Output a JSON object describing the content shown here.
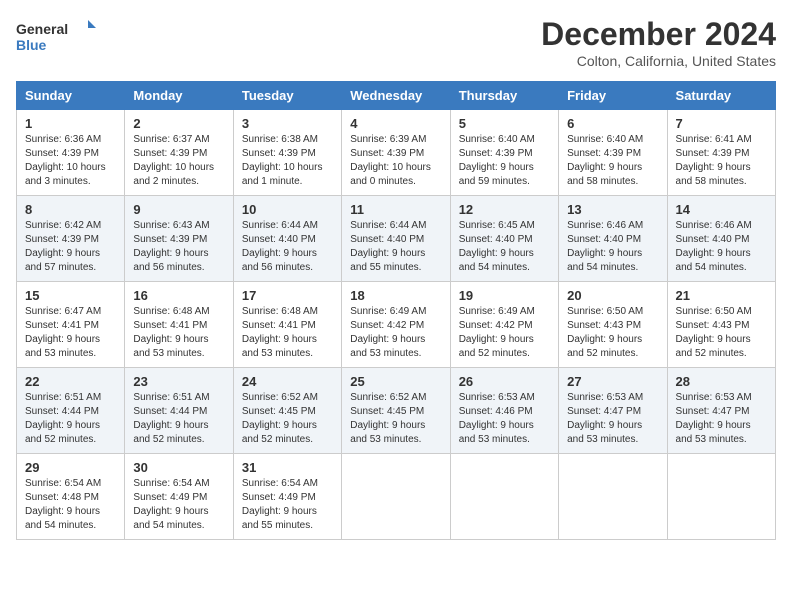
{
  "header": {
    "logo_line1": "General",
    "logo_line2": "Blue",
    "month": "December 2024",
    "location": "Colton, California, United States"
  },
  "days_of_week": [
    "Sunday",
    "Monday",
    "Tuesday",
    "Wednesday",
    "Thursday",
    "Friday",
    "Saturday"
  ],
  "weeks": [
    [
      {
        "day": "1",
        "info": "Sunrise: 6:36 AM\nSunset: 4:39 PM\nDaylight: 10 hours\nand 3 minutes."
      },
      {
        "day": "2",
        "info": "Sunrise: 6:37 AM\nSunset: 4:39 PM\nDaylight: 10 hours\nand 2 minutes."
      },
      {
        "day": "3",
        "info": "Sunrise: 6:38 AM\nSunset: 4:39 PM\nDaylight: 10 hours\nand 1 minute."
      },
      {
        "day": "4",
        "info": "Sunrise: 6:39 AM\nSunset: 4:39 PM\nDaylight: 10 hours\nand 0 minutes."
      },
      {
        "day": "5",
        "info": "Sunrise: 6:40 AM\nSunset: 4:39 PM\nDaylight: 9 hours\nand 59 minutes."
      },
      {
        "day": "6",
        "info": "Sunrise: 6:40 AM\nSunset: 4:39 PM\nDaylight: 9 hours\nand 58 minutes."
      },
      {
        "day": "7",
        "info": "Sunrise: 6:41 AM\nSunset: 4:39 PM\nDaylight: 9 hours\nand 58 minutes."
      }
    ],
    [
      {
        "day": "8",
        "info": "Sunrise: 6:42 AM\nSunset: 4:39 PM\nDaylight: 9 hours\nand 57 minutes."
      },
      {
        "day": "9",
        "info": "Sunrise: 6:43 AM\nSunset: 4:39 PM\nDaylight: 9 hours\nand 56 minutes."
      },
      {
        "day": "10",
        "info": "Sunrise: 6:44 AM\nSunset: 4:40 PM\nDaylight: 9 hours\nand 56 minutes."
      },
      {
        "day": "11",
        "info": "Sunrise: 6:44 AM\nSunset: 4:40 PM\nDaylight: 9 hours\nand 55 minutes."
      },
      {
        "day": "12",
        "info": "Sunrise: 6:45 AM\nSunset: 4:40 PM\nDaylight: 9 hours\nand 54 minutes."
      },
      {
        "day": "13",
        "info": "Sunrise: 6:46 AM\nSunset: 4:40 PM\nDaylight: 9 hours\nand 54 minutes."
      },
      {
        "day": "14",
        "info": "Sunrise: 6:46 AM\nSunset: 4:40 PM\nDaylight: 9 hours\nand 54 minutes."
      }
    ],
    [
      {
        "day": "15",
        "info": "Sunrise: 6:47 AM\nSunset: 4:41 PM\nDaylight: 9 hours\nand 53 minutes."
      },
      {
        "day": "16",
        "info": "Sunrise: 6:48 AM\nSunset: 4:41 PM\nDaylight: 9 hours\nand 53 minutes."
      },
      {
        "day": "17",
        "info": "Sunrise: 6:48 AM\nSunset: 4:41 PM\nDaylight: 9 hours\nand 53 minutes."
      },
      {
        "day": "18",
        "info": "Sunrise: 6:49 AM\nSunset: 4:42 PM\nDaylight: 9 hours\nand 53 minutes."
      },
      {
        "day": "19",
        "info": "Sunrise: 6:49 AM\nSunset: 4:42 PM\nDaylight: 9 hours\nand 52 minutes."
      },
      {
        "day": "20",
        "info": "Sunrise: 6:50 AM\nSunset: 4:43 PM\nDaylight: 9 hours\nand 52 minutes."
      },
      {
        "day": "21",
        "info": "Sunrise: 6:50 AM\nSunset: 4:43 PM\nDaylight: 9 hours\nand 52 minutes."
      }
    ],
    [
      {
        "day": "22",
        "info": "Sunrise: 6:51 AM\nSunset: 4:44 PM\nDaylight: 9 hours\nand 52 minutes."
      },
      {
        "day": "23",
        "info": "Sunrise: 6:51 AM\nSunset: 4:44 PM\nDaylight: 9 hours\nand 52 minutes."
      },
      {
        "day": "24",
        "info": "Sunrise: 6:52 AM\nSunset: 4:45 PM\nDaylight: 9 hours\nand 52 minutes."
      },
      {
        "day": "25",
        "info": "Sunrise: 6:52 AM\nSunset: 4:45 PM\nDaylight: 9 hours\nand 53 minutes."
      },
      {
        "day": "26",
        "info": "Sunrise: 6:53 AM\nSunset: 4:46 PM\nDaylight: 9 hours\nand 53 minutes."
      },
      {
        "day": "27",
        "info": "Sunrise: 6:53 AM\nSunset: 4:47 PM\nDaylight: 9 hours\nand 53 minutes."
      },
      {
        "day": "28",
        "info": "Sunrise: 6:53 AM\nSunset: 4:47 PM\nDaylight: 9 hours\nand 53 minutes."
      }
    ],
    [
      {
        "day": "29",
        "info": "Sunrise: 6:54 AM\nSunset: 4:48 PM\nDaylight: 9 hours\nand 54 minutes."
      },
      {
        "day": "30",
        "info": "Sunrise: 6:54 AM\nSunset: 4:49 PM\nDaylight: 9 hours\nand 54 minutes."
      },
      {
        "day": "31",
        "info": "Sunrise: 6:54 AM\nSunset: 4:49 PM\nDaylight: 9 hours\nand 55 minutes."
      },
      null,
      null,
      null,
      null
    ]
  ]
}
